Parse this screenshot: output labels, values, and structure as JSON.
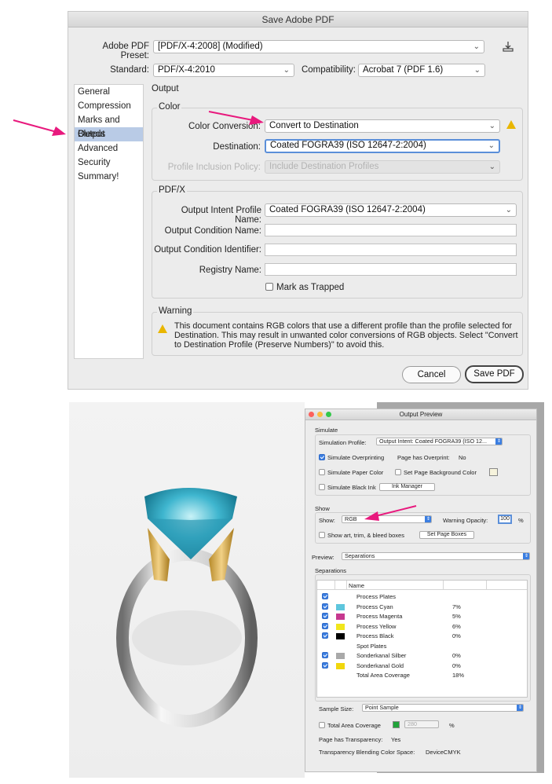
{
  "pdf_dialog": {
    "title": "Save Adobe PDF",
    "preset_label": "Adobe PDF Preset:",
    "preset_value": "[PDF/X-4:2008] (Modified)",
    "standard_label": "Standard:",
    "standard_value": "PDF/X-4:2010",
    "compat_label": "Compatibility:",
    "compat_value": "Acrobat 7 (PDF 1.6)",
    "nav": [
      {
        "label": "General"
      },
      {
        "label": "Compression"
      },
      {
        "label": "Marks and Bleeds"
      },
      {
        "label": "Output"
      },
      {
        "label": "Advanced"
      },
      {
        "label": "Security"
      },
      {
        "label": "Summary!"
      }
    ],
    "section_title": "Output",
    "color": {
      "title": "Color",
      "conversion_label": "Color Conversion:",
      "conversion_value": "Convert to Destination",
      "destination_label": "Destination:",
      "destination_value": "Coated FOGRA39 (ISO 12647-2:2004)",
      "profile_label": "Profile Inclusion Policy:",
      "profile_value": "Include Destination Profiles"
    },
    "pdfx": {
      "title": "PDF/X",
      "intent_label": "Output Intent Profile Name:",
      "intent_value": "Coated FOGRA39 (ISO 12647-2:2004)",
      "cond_name_label": "Output Condition Name:",
      "cond_id_label": "Output Condition Identifier:",
      "registry_label": "Registry Name:",
      "trapped_label": "Mark as Trapped"
    },
    "warning": {
      "title": "Warning",
      "text": "This document contains RGB colors that use a different profile than the profile selected for Destination.  This may result in unwanted color conversions of RGB objects.  Select \"Convert to Destination Profile (Preserve Numbers)\" to avoid this."
    },
    "cancel_label": "Cancel",
    "save_label": "Save PDF"
  },
  "output_preview": {
    "title": "Output Preview",
    "simulate_title": "Simulate",
    "sim_profile_label": "Simulation Profile:",
    "sim_profile_value": "Output Intent: Coated FOGRA39 (ISO 12...",
    "sim_overprint_label": "Simulate Overprinting",
    "page_overprint_label": "Page has Overprint:",
    "page_overprint_value": "No",
    "paper_color_label": "Simulate Paper Color",
    "page_bg_label": "Set Page Background Color",
    "black_ink_label": "Simulate Black Ink",
    "ink_manager_label": "Ink Manager",
    "show_title": "Show",
    "show_label": "Show:",
    "show_value": "RGB",
    "warning_opacity_label": "Warning Opacity:",
    "warning_opacity_value": "100",
    "percent": "%",
    "show_boxes_label": "Show art, trim, & bleed boxes",
    "set_page_boxes_label": "Set Page Boxes",
    "preview_label": "Preview:",
    "preview_value": "Separations",
    "separations_title": "Separations",
    "col_name": "Name",
    "rows": [
      {
        "check": true,
        "swatch": "#5ec6dd",
        "name": "Process Plates",
        "value": "",
        "header": true
      },
      {
        "check": true,
        "swatch": "#5ec6dd",
        "name": "Process Cyan",
        "value": "7%"
      },
      {
        "check": true,
        "swatch": "#c6398f",
        "name": "Process Magenta",
        "value": "5%"
      },
      {
        "check": true,
        "swatch": "#f1e61b",
        "name": "Process Yellow",
        "value": "6%"
      },
      {
        "check": true,
        "swatch": "#000000",
        "name": "Process Black",
        "value": "0%"
      },
      {
        "check": false,
        "swatch": "",
        "name": "Spot Plates",
        "value": "",
        "header": true
      },
      {
        "check": true,
        "swatch": "#a9a9a9",
        "name": "Sonderkanal Silber",
        "value": "0%"
      },
      {
        "check": true,
        "swatch": "#f1d70c",
        "name": "Sonderkanal Gold",
        "value": "0%"
      },
      {
        "check": false,
        "swatch": "",
        "name": "Total Area Coverage",
        "value": "18%"
      }
    ],
    "sample_size_label": "Sample Size:",
    "sample_size_value": "Point Sample",
    "total_area_label": "Total Area Coverage",
    "total_area_value": "280",
    "page_transparency_label": "Page has Transparency:",
    "page_transparency_value": "Yes",
    "blend_space_label": "Transparency Blending Color Space:",
    "blend_space_value": "DeviceCMYK"
  },
  "colors": {
    "arrow": "#e8197d",
    "accent": "#3b7ee1",
    "nav_selected": "#b9cbe6"
  }
}
